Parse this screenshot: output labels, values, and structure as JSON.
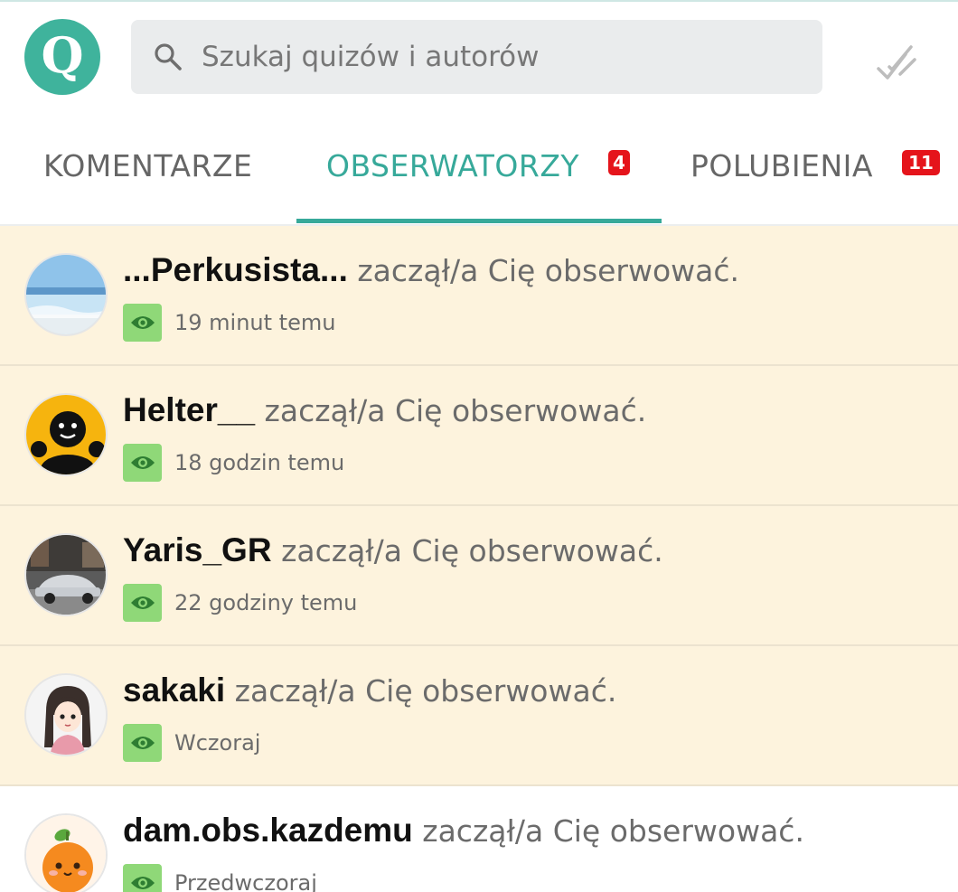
{
  "header": {
    "logo_letter": "Q",
    "search_placeholder": "Szukaj quizów i autorów"
  },
  "tabs": [
    {
      "label": "KOMENTARZE",
      "badge": ""
    },
    {
      "label": "OBSERWATORZY",
      "badge": "4",
      "active": true
    },
    {
      "label": "POLUBIENIA",
      "badge": "11"
    }
  ],
  "notifications": [
    {
      "user": "...Perkusista...",
      "action": "zaczął/a Cię obserwować.",
      "time": "19 minut temu",
      "unread": true,
      "avatar": "sea-photo"
    },
    {
      "user": "Helter__",
      "action": "zaczął/a Cię obserwować.",
      "time": "18 godzin temu",
      "unread": true,
      "avatar": "smiley-face"
    },
    {
      "user": "Yaris_GR",
      "action": "zaczął/a Cię obserwować.",
      "time": "22 godziny temu",
      "unread": true,
      "avatar": "car-photo"
    },
    {
      "user": "sakaki",
      "action": "zaczął/a Cię obserwować.",
      "time": "Wczoraj",
      "unread": true,
      "avatar": "anime-girl"
    },
    {
      "user": "dam.obs.kazdemu",
      "action": "zaczął/a Cię obserwować.",
      "time": "Przedwczoraj",
      "unread": false,
      "avatar": "orange-character"
    }
  ],
  "colors": {
    "accent": "#37a99a",
    "logo": "#3fb39c",
    "badge": "#e5141b",
    "unread_row": "#fdf3dd",
    "eye_bg": "#8fd878"
  }
}
